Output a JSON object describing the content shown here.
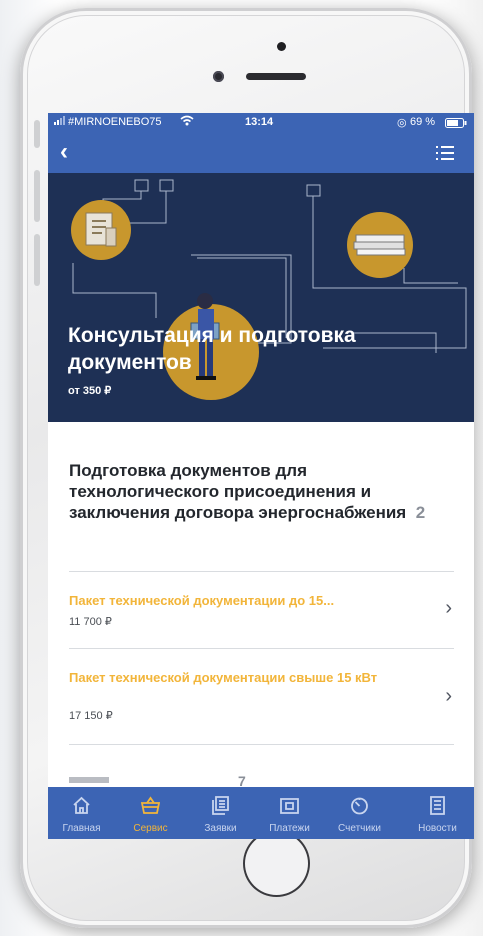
{
  "status_bar": {
    "carrier": "#MIRNOENEBO75",
    "time": "13:14",
    "battery": "69 %"
  },
  "nav": {
    "back_icon": "chevron-left-icon",
    "menu_icon": "list-icon"
  },
  "hero": {
    "title": "Консультация и подготовка документов",
    "price": "от 350 ₽"
  },
  "section": {
    "title": "Подготовка документов для технологического присоединения и заключения договора энергоснабжения",
    "count": "2"
  },
  "items": [
    {
      "title": "Пакет технической документации до 15...",
      "price": "11 700 ₽"
    },
    {
      "title": "Пакет технической документации свыше 15 кВт",
      "price": "17 150 ₽"
    }
  ],
  "next_section_partial": {
    "count": "7"
  },
  "tabs": [
    {
      "label": "Главная",
      "icon": "home-icon",
      "active": false
    },
    {
      "label": "Сервис",
      "icon": "basket-icon",
      "active": true
    },
    {
      "label": "Заявки",
      "icon": "documents-icon",
      "active": false
    },
    {
      "label": "Платежи",
      "icon": "wallet-icon",
      "active": false
    },
    {
      "label": "Счетчики",
      "icon": "meter-icon",
      "active": false
    },
    {
      "label": "Новости",
      "icon": "news-icon",
      "active": false
    }
  ],
  "colors": {
    "primary": "#3c64b4",
    "hero_bg": "#1e3055",
    "accent": "#f2b53a",
    "text_dark": "#23272d"
  }
}
